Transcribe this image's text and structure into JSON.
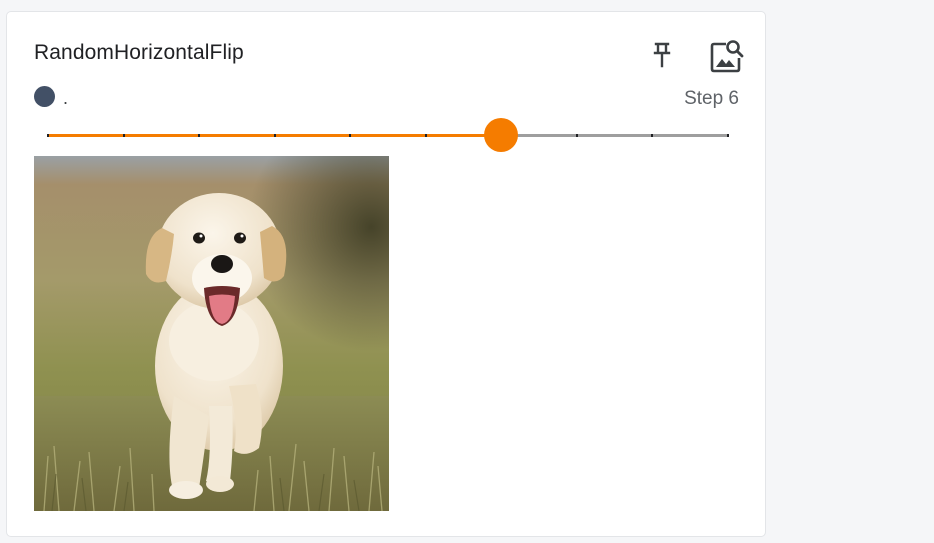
{
  "card": {
    "title": "RandomHorizontalFlip",
    "pin_icon": "pin-icon",
    "zoom_icon": "image-search-icon"
  },
  "run": {
    "name": ".",
    "color": "#425066"
  },
  "step": {
    "label": "Step 6",
    "current": 6,
    "min": 0,
    "max": 9
  },
  "slider": {
    "accent": "#f57c00",
    "track_color": "#9e9e9e"
  },
  "image": {
    "subject": "golden retriever puppy walking on grass"
  }
}
